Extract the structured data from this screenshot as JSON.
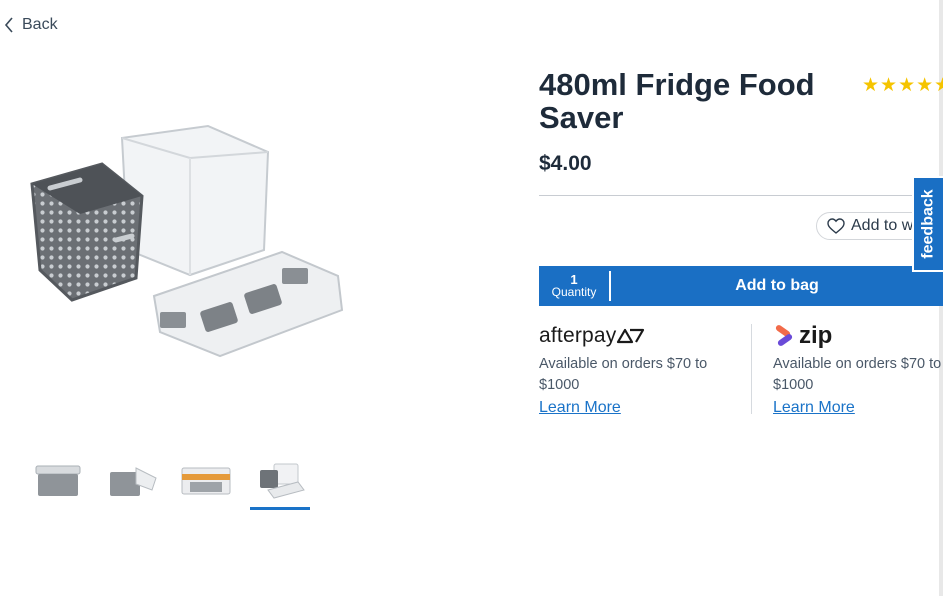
{
  "nav": {
    "back_label": "Back"
  },
  "product": {
    "title": "480ml Fridge Food Saver",
    "rating_stars": "★★★★★",
    "price": "$4.00"
  },
  "wishlist": {
    "label": "Add to wishlist"
  },
  "bag": {
    "quantity_value": "1",
    "quantity_label": "Quantity",
    "add_label": "Add to bag"
  },
  "payments": {
    "afterpay": {
      "logo": "afterpay",
      "info": "Available on orders $70 to $1000",
      "link": "Learn More"
    },
    "zip": {
      "logo": "zip",
      "info": "Available on orders $70 to $1000",
      "link": "Learn More"
    }
  },
  "feedback": {
    "label": "feedback"
  },
  "colors": {
    "accent": "#1a6fc4",
    "link": "#1a73c8",
    "star": "#f5c400",
    "text": "#1e2b3a"
  },
  "gallery": {
    "thumb_count": 4,
    "active_thumb": 4
  }
}
